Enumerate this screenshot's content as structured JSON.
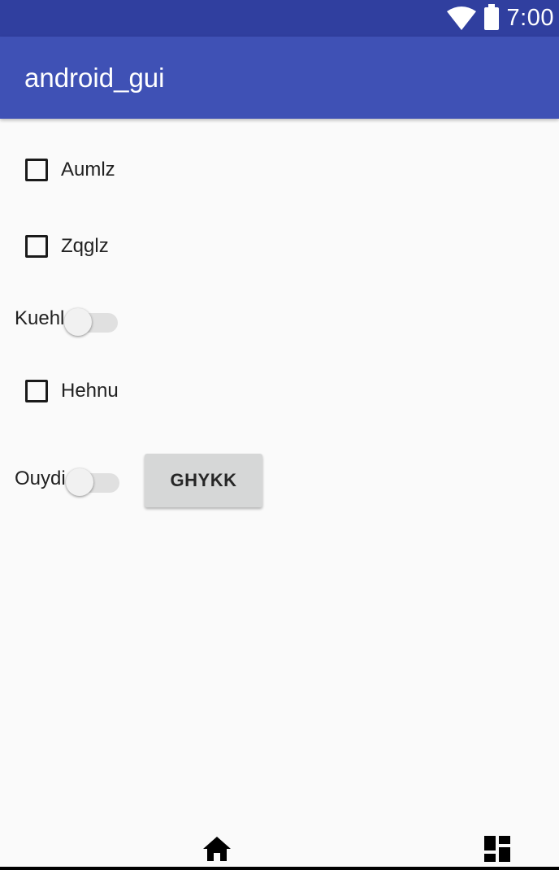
{
  "status_bar": {
    "time": "7:00",
    "icons": [
      "wifi-icon",
      "battery-icon"
    ],
    "color": "#303f9f"
  },
  "app_bar": {
    "title": "android_gui",
    "color": "#3f51b5"
  },
  "controls": {
    "checkbox_1": {
      "label": "Aumlz",
      "checked": false
    },
    "checkbox_2": {
      "label": "Zqglz",
      "checked": false
    },
    "switch_1": {
      "label": "Kuehl",
      "on": false
    },
    "checkbox_3": {
      "label": "Hehnu",
      "checked": false
    },
    "switch_2": {
      "label": "Ouydi",
      "on": false
    },
    "button": {
      "label": "GHYKK"
    }
  },
  "nav_bar": {
    "icons": [
      "home-icon",
      "dashboard-icon"
    ]
  }
}
